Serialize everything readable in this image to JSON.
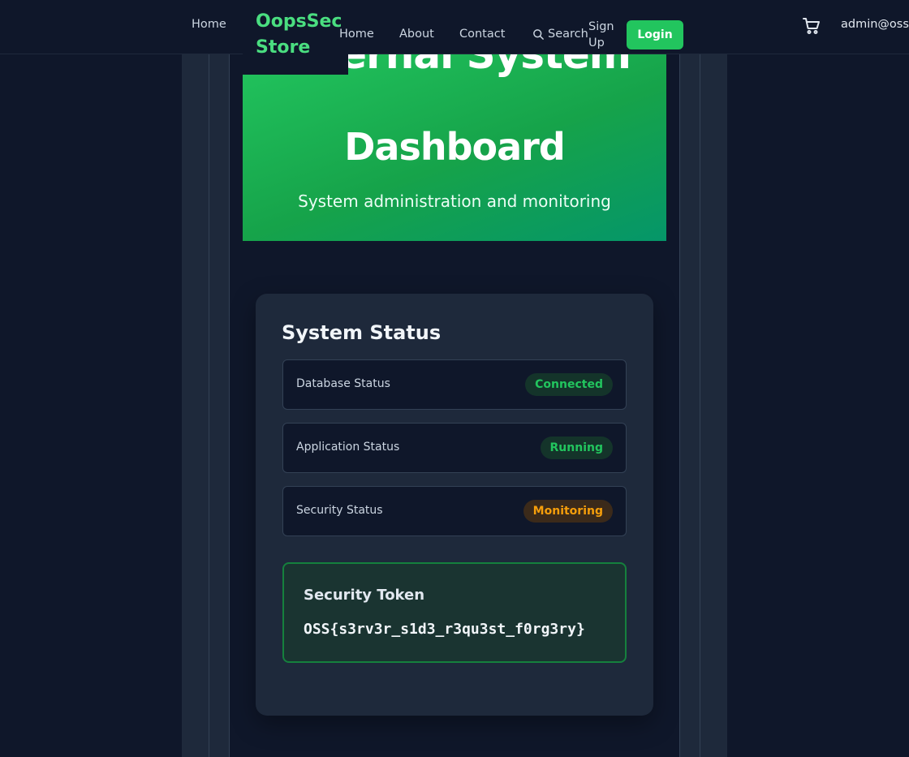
{
  "brand": {
    "name": "OopsSec Store",
    "color": "#4ade80"
  },
  "nav": {
    "home_outer": "Home",
    "home": "Home",
    "about": "About",
    "contact": "Contact",
    "search": "Search",
    "signup": "Sign Up",
    "login": "Login",
    "cart_icon": "cart-icon",
    "user": "admin@oss"
  },
  "hero": {
    "title_partial": "Internal System",
    "title": "Dashboard",
    "subtitle": "System administration and monitoring"
  },
  "status_card": {
    "title": "System Status",
    "rows": [
      {
        "label": "Database Status",
        "value": "Connected",
        "tone": "green"
      },
      {
        "label": "Application Status",
        "value": "Running",
        "tone": "green"
      },
      {
        "label": "Security Status",
        "value": "Monitoring",
        "tone": "orange"
      }
    ]
  },
  "token": {
    "title": "Security Token",
    "value": "OSS{s3rv3r_s1d3_r3qu3st_f0rg3ry}"
  },
  "colors": {
    "accent": "#22c55e",
    "warning": "#f59e0b",
    "background": "#0f172a",
    "card": "#1e293b"
  }
}
